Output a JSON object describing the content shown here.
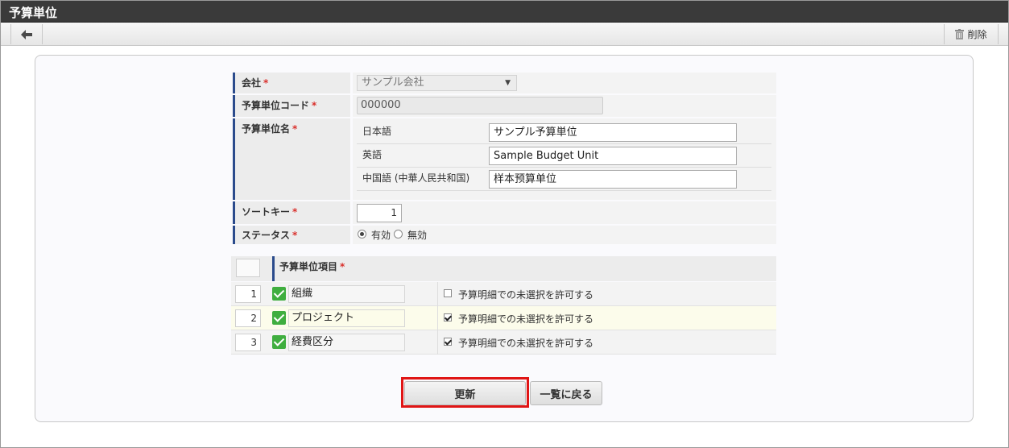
{
  "window": {
    "title": "予算単位"
  },
  "toolbar": {
    "back_icon": "arrow-left-icon",
    "delete_icon": "trash-icon",
    "delete_label": "削除"
  },
  "form": {
    "company": {
      "label": "会社",
      "required": "*",
      "value": "サンプル会社"
    },
    "code": {
      "label": "予算単位コード",
      "required": "*",
      "value": "000000"
    },
    "name": {
      "label": "予算単位名",
      "required": "*",
      "langs": [
        {
          "lang": "日本語",
          "value": "サンプル予算単位"
        },
        {
          "lang": "英語",
          "value": "Sample Budget Unit"
        },
        {
          "lang": "中国語 (中華人民共和国)",
          "value": "样本预算单位"
        }
      ]
    },
    "sort_key": {
      "label": "ソートキー",
      "required": "*",
      "value": "1"
    },
    "status": {
      "label": "ステータス",
      "required": "*",
      "options": [
        "有効",
        "無効"
      ],
      "selected": "有効"
    }
  },
  "items": {
    "header": "予算単位項目",
    "required": "*",
    "rows": [
      {
        "no": "1",
        "name": "組織",
        "allow_unselected_label": "予算明細での未選択を許可する",
        "allow_unselected": false
      },
      {
        "no": "2",
        "name": "プロジェクト",
        "allow_unselected_label": "予算明細での未選択を許可する",
        "allow_unselected": true
      },
      {
        "no": "3",
        "name": "経費区分",
        "allow_unselected_label": "予算明細での未選択を許可する",
        "allow_unselected": true
      }
    ]
  },
  "buttons": {
    "update": "更新",
    "back_to_list": "一覧に戻る"
  },
  "colors": {
    "accent": "#2b4b8c",
    "required": "#d9302c",
    "checkbox": "#3fae3f",
    "highlight": "#e01515",
    "titlebar": "#3a3a3a"
  }
}
